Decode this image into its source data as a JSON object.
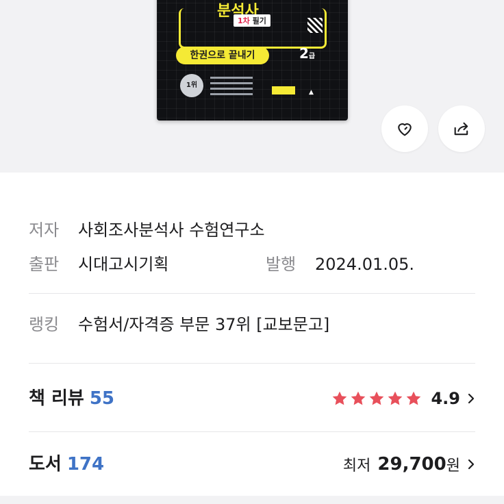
{
  "cover": {
    "big_title": "분석사",
    "level_badge_hl": "1차",
    "level_badge_rest": "필기",
    "slogan": "한권으로 끝내기",
    "grade_num": "2",
    "grade_unit": "급",
    "rank_text": "1위"
  },
  "actions": {
    "like_icon": "heart-icon",
    "share_icon": "share-icon"
  },
  "info": {
    "author_label": "저자",
    "author_value": "사회조사분석사 수험연구소",
    "publisher_label": "출판",
    "publisher_value": "시대고시기획",
    "date_label": "발행",
    "date_value": "2024.01.05.",
    "ranking_label": "랭킹",
    "ranking_value": "수험서/자격증 부문 37위 [교보문고]"
  },
  "review": {
    "label": "책 리뷰",
    "count": "55",
    "rating": "4.9",
    "stars_filled": 5,
    "star_color": "#e8505b"
  },
  "books": {
    "label": "도서",
    "count": "174",
    "price_label": "최저",
    "price_value": "29,700",
    "price_unit": "원"
  },
  "colors": {
    "accent_blue": "#3f73c6",
    "star_red": "#e8505b",
    "neon_yellow": "#f5ea35"
  }
}
